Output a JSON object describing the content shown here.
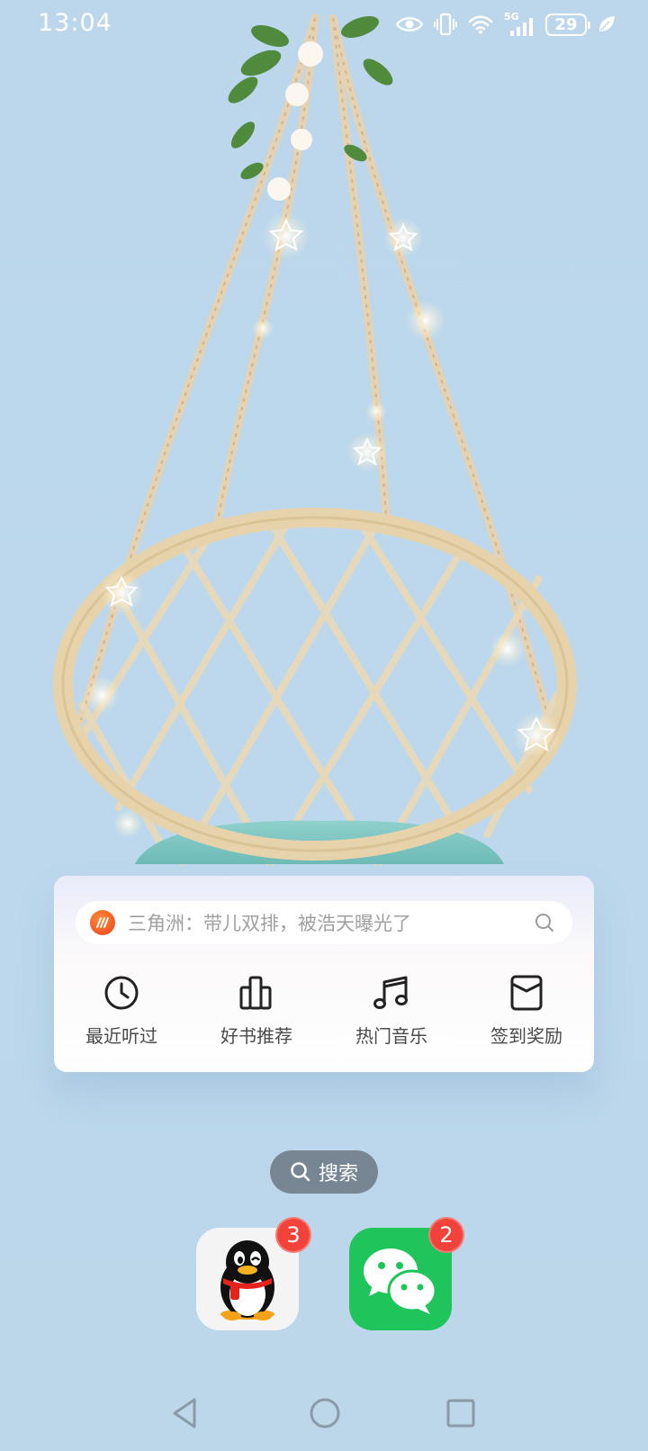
{
  "status_bar": {
    "time": "13:04",
    "network": "5G",
    "battery": "29",
    "icons": [
      "eye-icon",
      "vibrate-icon",
      "wifi-icon",
      "signal-icon",
      "battery-icon",
      "leaf-icon"
    ]
  },
  "wallpaper": {
    "description_icon": "hanging-chair-wallpaper"
  },
  "widget": {
    "search_text": "三角洲：带儿双排，被浩天曝光了",
    "actions": [
      {
        "label": "最近听过",
        "icon": "clock-icon"
      },
      {
        "label": "好书推荐",
        "icon": "books-icon"
      },
      {
        "label": "热门音乐",
        "icon": "music-note-icon"
      },
      {
        "label": "签到奖励",
        "icon": "gift-card-icon"
      }
    ]
  },
  "search_pill": {
    "label": "搜索"
  },
  "dock": [
    {
      "app": "QQ",
      "badge": "3"
    },
    {
      "app": "WeChat",
      "badge": "2"
    }
  ],
  "colors": {
    "background": "#bcd7ec",
    "badge": "#f2433a",
    "wechat": "#1fc45a"
  }
}
